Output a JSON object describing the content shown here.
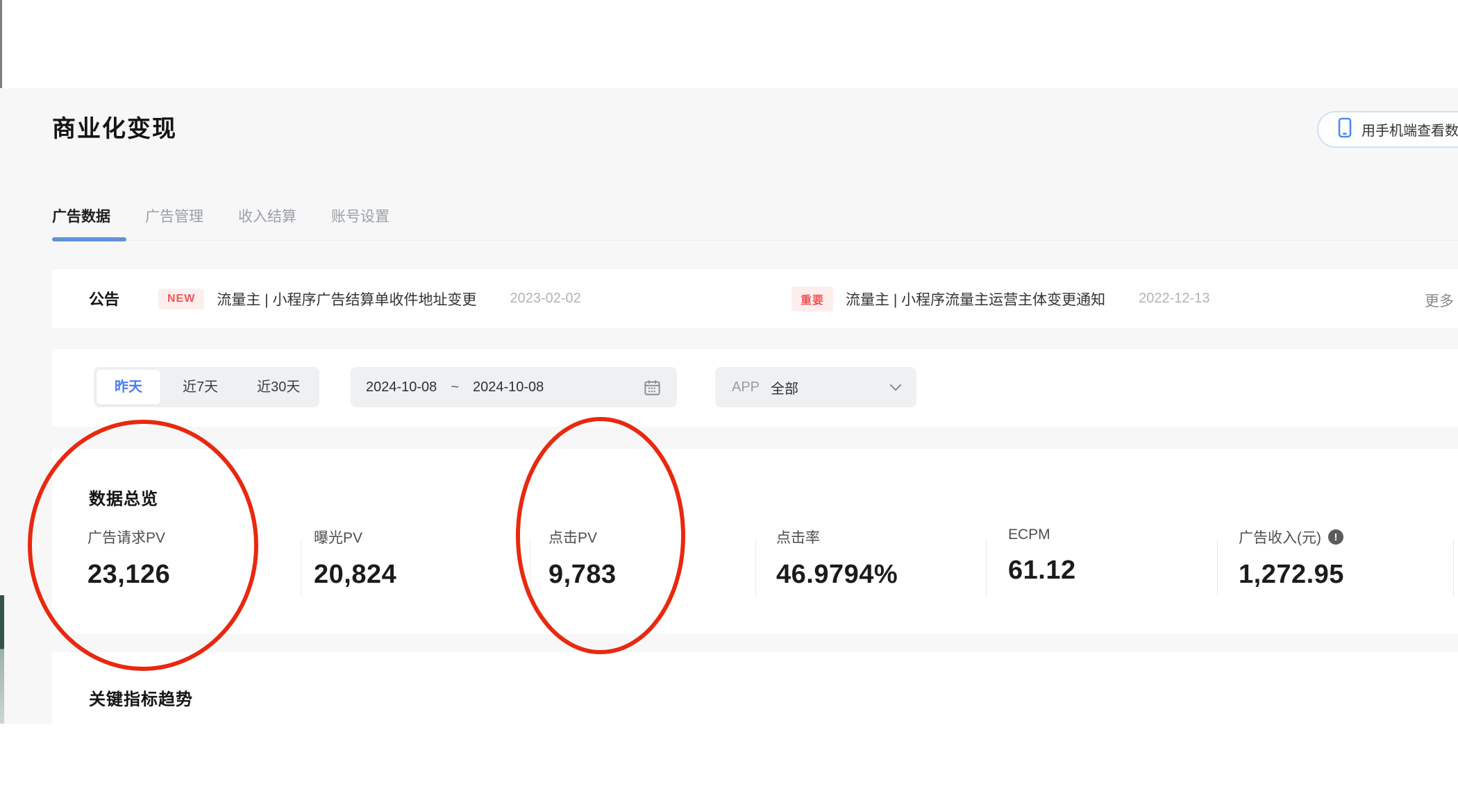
{
  "page_title": "商业化变现",
  "header": {
    "mobile_view_button": "用手机端查看数据"
  },
  "tabs": [
    {
      "label": "广告数据",
      "active": true
    },
    {
      "label": "广告管理",
      "active": false
    },
    {
      "label": "收入结算",
      "active": false
    },
    {
      "label": "账号设置",
      "active": false
    }
  ],
  "announcement": {
    "title": "公告",
    "items": [
      {
        "badge": "NEW",
        "text": "流量主 | 小程序广告结算单收件地址变更",
        "date": "2023-02-02"
      },
      {
        "badge": "重要",
        "text": "流量主 | 小程序流量主运营主体变更通知",
        "date": "2022-12-13"
      }
    ],
    "more": "更多"
  },
  "filters": {
    "quick_ranges": [
      {
        "label": "昨天",
        "selected": true
      },
      {
        "label": "近7天",
        "selected": false
      },
      {
        "label": "近30天",
        "selected": false
      }
    ],
    "date_start": "2024-10-08",
    "date_separator": "~",
    "date_end": "2024-10-08",
    "app_label": "APP",
    "app_value": "全部"
  },
  "overview": {
    "title": "数据总览",
    "metrics": [
      {
        "label": "广告请求PV",
        "value": "23,126"
      },
      {
        "label": "曝光PV",
        "value": "20,824"
      },
      {
        "label": "点击PV",
        "value": "9,783"
      },
      {
        "label": "点击率",
        "value": "46.9794%"
      },
      {
        "label": "ECPM",
        "value": "61.12"
      },
      {
        "label": "广告收入(元)",
        "value": "1,272.95"
      }
    ],
    "info_icon_glyph": "!"
  },
  "trends": {
    "title": "关键指标趋势"
  },
  "annotations": {
    "color": "#e8290f",
    "targets": [
      "广告请求PV 23,126",
      "点击PV 9,783"
    ]
  },
  "colors": {
    "accent_blue": "#4a7ef0",
    "tab_underline": "#5e92da",
    "badge_text": "#f25555",
    "badge_bg": "#fdeeee",
    "page_bg": "#f7f7f8",
    "card_bg": "#ffffff"
  }
}
